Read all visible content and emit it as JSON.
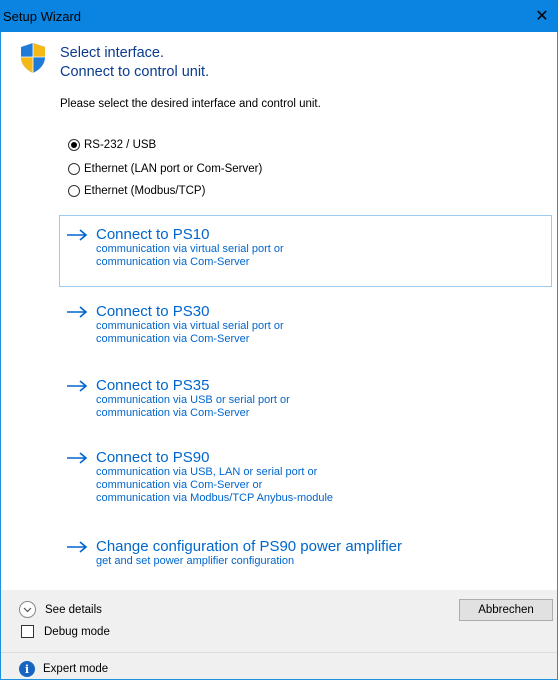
{
  "window": {
    "title": "Setup Wizard",
    "close_glyph": "✕"
  },
  "header": {
    "icon": "uac-shield-icon",
    "instruction_line1": "Select interface.",
    "instruction_line2": "Connect to control unit.",
    "prompt": "Please select the desired interface and control unit."
  },
  "interfaces": {
    "selected": "RS-232 / USB",
    "options": [
      {
        "label": "RS-232 / USB",
        "checked": true
      },
      {
        "label": "Ethernet (LAN port or Com-Server)",
        "checked": false
      },
      {
        "label": "Ethernet (Modbus/TCP)",
        "checked": false
      }
    ]
  },
  "commands": [
    {
      "title": "Connect to PS10",
      "desc": "communication via virtual serial port or\ncommunication via Com-Server",
      "focused": true
    },
    {
      "title": "Connect to PS30",
      "desc": "communication via virtual serial port or\ncommunication via Com-Server",
      "focused": false
    },
    {
      "title": "Connect to PS35",
      "desc": "communication via USB or serial port or\ncommunication via Com-Server",
      "focused": false
    },
    {
      "title": "Connect to PS90",
      "desc": "communication via USB, LAN or serial port or\ncommunication via Com-Server or\ncommunication via Modbus/TCP Anybus-module",
      "focused": false
    },
    {
      "title": "Change configuration of PS90 power amplifier",
      "desc": "get and set power amplifier configuration",
      "focused": false
    }
  ],
  "footer": {
    "details_label": "See details",
    "cancel_label": "Abbrechen",
    "debug_label": "Debug mode",
    "debug_checked": false,
    "expert_label": "Expert mode",
    "expert_glyph": "i"
  },
  "colors": {
    "titlebar": "#0a84e0",
    "link": "#0066cc",
    "instruction": "#0a3b8f",
    "footer_bg": "#f0f0f0"
  }
}
